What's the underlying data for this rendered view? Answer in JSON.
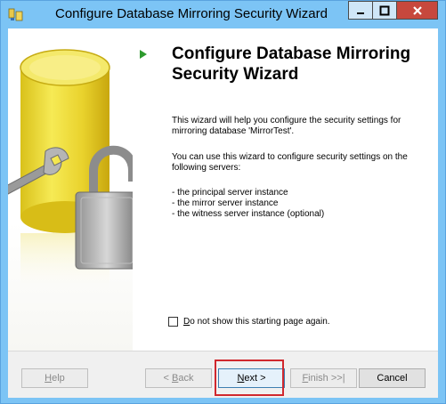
{
  "window": {
    "title": "Configure Database Mirroring Security Wizard"
  },
  "icons": {
    "app": "database-mirroring-app-icon",
    "minimize": "minimize-icon",
    "maximize": "maximize-icon",
    "close": "close-icon",
    "arrow": "green-arrow-icon",
    "art": "database-wrench-padlock-illustration"
  },
  "content": {
    "heading": "Configure Database Mirroring Security Wizard",
    "para1": "This wizard will help you configure the security settings for mirroring database 'MirrorTest'.",
    "para2": "You can use this wizard to configure security settings on the following servers:",
    "list": [
      "- the principal server instance",
      "- the mirror server instance",
      "- the witness server instance (optional)"
    ],
    "checkbox": {
      "prefix": "",
      "underline": "D",
      "rest": "o not show this starting page again.",
      "checked": false
    }
  },
  "buttons": {
    "help": {
      "underline": "H",
      "rest": "elp",
      "enabled": false
    },
    "back": {
      "prefix": "< ",
      "underline": "B",
      "rest": "ack",
      "enabled": false
    },
    "next": {
      "underline": "N",
      "rest": "ext >",
      "enabled": true
    },
    "finish": {
      "prefix": "",
      "underline": "F",
      "rest": "inish >>|",
      "enabled": false
    },
    "cancel": {
      "label": "Cancel",
      "enabled": true
    }
  },
  "colors": {
    "titlebar": "#7cc4f5",
    "close_button": "#c7483d",
    "highlight": "#d0282e",
    "arrow": "#2e9a2e"
  }
}
